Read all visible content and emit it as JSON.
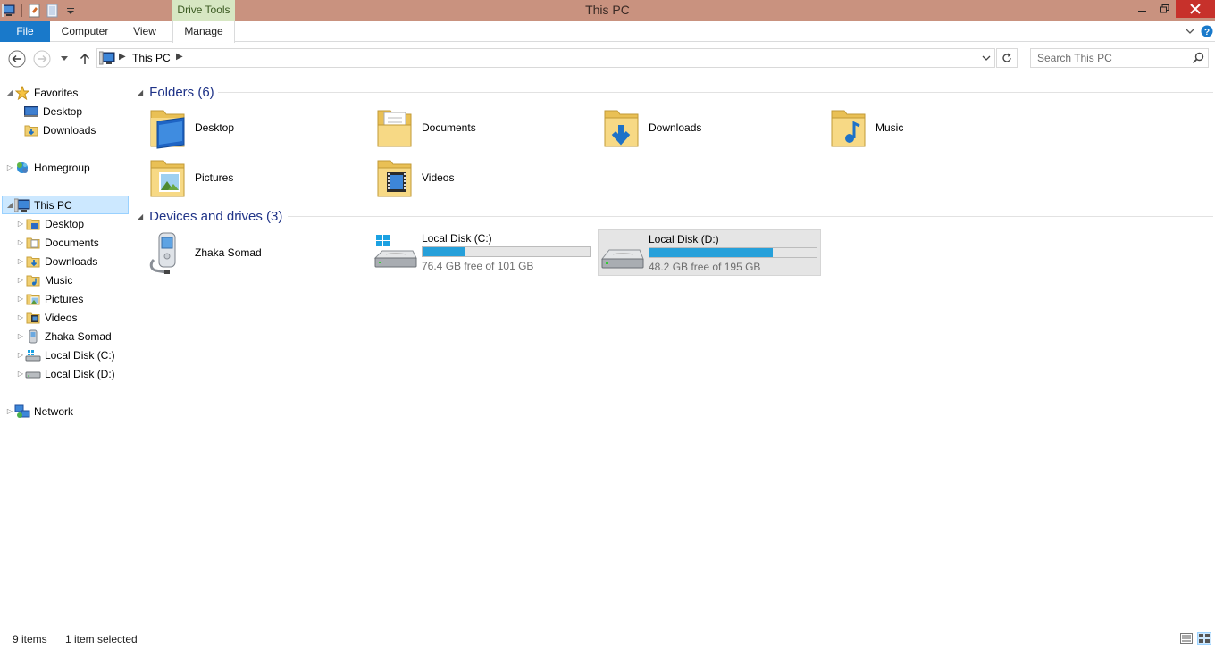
{
  "window": {
    "title": "This PC",
    "context_tab": "Drive Tools"
  },
  "ribbon": {
    "tabs": [
      {
        "label": "File"
      },
      {
        "label": "Computer"
      },
      {
        "label": "View"
      },
      {
        "label": "Manage"
      }
    ]
  },
  "address": {
    "path": "This PC",
    "search_placeholder": "Search This PC"
  },
  "nav": {
    "favorites": {
      "label": "Favorites",
      "items": [
        {
          "label": "Desktop"
        },
        {
          "label": "Downloads"
        }
      ]
    },
    "homegroup": {
      "label": "Homegroup"
    },
    "this_pc": {
      "label": "This PC",
      "items": [
        {
          "label": "Desktop"
        },
        {
          "label": "Documents"
        },
        {
          "label": "Downloads"
        },
        {
          "label": "Music"
        },
        {
          "label": "Pictures"
        },
        {
          "label": "Videos"
        },
        {
          "label": "Zhaka Somad"
        },
        {
          "label": "Local Disk (C:)"
        },
        {
          "label": "Local Disk (D:)"
        }
      ]
    },
    "network": {
      "label": "Network"
    }
  },
  "content": {
    "folders_header": "Folders (6)",
    "folders": [
      {
        "label": "Desktop",
        "icon": "folder-desktop-icon"
      },
      {
        "label": "Documents",
        "icon": "folder-documents-icon"
      },
      {
        "label": "Downloads",
        "icon": "folder-downloads-icon"
      },
      {
        "label": "Music",
        "icon": "folder-music-icon"
      },
      {
        "label": "Pictures",
        "icon": "folder-pictures-icon"
      },
      {
        "label": "Videos",
        "icon": "folder-videos-icon"
      }
    ],
    "devices_header": "Devices and drives (3)",
    "device": {
      "label": "Zhaka Somad",
      "icon": "phone-device-icon"
    },
    "drives": [
      {
        "label": "Local Disk (C:)",
        "free_text": "76.4 GB free of 101 GB",
        "used_fraction": 0.25,
        "selected": false
      },
      {
        "label": "Local Disk (D:)",
        "free_text": "48.2 GB free of 195 GB",
        "used_fraction": 0.74,
        "selected": true
      }
    ]
  },
  "status": {
    "items": "9 items",
    "selection": "1 item selected"
  },
  "colors": {
    "titlebar": "#c9927f",
    "file_tab": "#1979ca",
    "context_tab": "#d7e7c3",
    "close_button": "#c7312b",
    "drive_bar": "#26a0da",
    "group_header": "#1e3287",
    "selection": "#cce8ff"
  }
}
